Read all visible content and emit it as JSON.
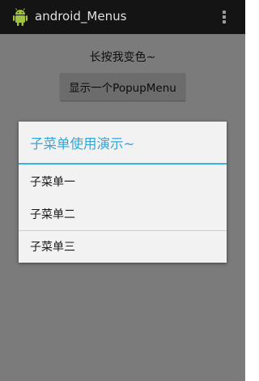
{
  "action_bar": {
    "title": "android_Menus",
    "app_icon": "android-robot-icon",
    "overflow_icon": "overflow-menu-icon"
  },
  "content": {
    "long_press_text": "长按我变色~",
    "popup_button_label": "显示一个PopupMenu"
  },
  "dialog": {
    "title": "子菜单使用演示~",
    "items": [
      {
        "label": "子菜单一"
      },
      {
        "label": "子菜单二"
      },
      {
        "label": "子菜单三"
      }
    ]
  },
  "colors": {
    "accent": "#33b5e5",
    "action_bar": "#141414",
    "dim_background": "#7b7b7b",
    "dialog_background": "#f2f2f2"
  }
}
